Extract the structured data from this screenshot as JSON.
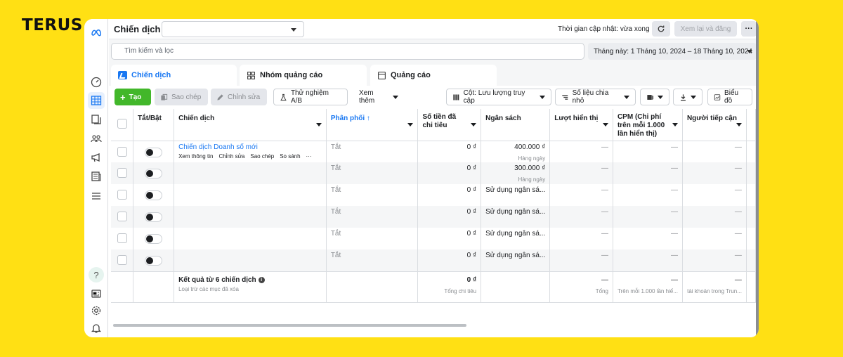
{
  "brand": {
    "text": "TERUS"
  },
  "topbar": {
    "title": "Chiến dịch",
    "campaign_select_value": "",
    "update_status": "Thời gian cập nhật: vừa xong",
    "review_button": "Xem lại và đăng",
    "more_button": "···"
  },
  "search": {
    "placeholder": "Tìm kiếm và lọc"
  },
  "date_range": "Tháng này: 1 Tháng 10, 2024 – 18 Tháng 10, 2024",
  "tabs": [
    {
      "label": "Chiến dịch"
    },
    {
      "label": "Nhóm quảng cáo"
    },
    {
      "label": "Quảng cáo"
    }
  ],
  "toolbar": {
    "create": "Tạo",
    "copy": "Sao chép",
    "edit": "Chỉnh sửa",
    "ab_test": "Thử nghiệm A/B",
    "see_more": "Xem thêm",
    "columns": "Cột: Lưu lượng truy cập",
    "breakdown": "Số liệu chia nhỏ",
    "chart": "Biểu đồ"
  },
  "columns": {
    "onoff": "Tắt/Bật",
    "campaign": "Chiến dịch",
    "delivery": "Phân phối ↑",
    "spent": "Số tiền đã chi tiêu",
    "budget": "Ngân sách",
    "impressions": "Lượt hiển thị",
    "cpm": "CPM (Chi phí trên mỗi 1.000 lần hiển thị)",
    "reach": "Người tiếp cận"
  },
  "rows": [
    {
      "name": "Chiến dịch Doanh số mới",
      "delivery": "Tắt",
      "spent": "0 ₫",
      "budget": "400.000 ₫",
      "budget_sub": "Hàng ngày",
      "impressions": "—",
      "cpm": "—",
      "reach": "—"
    },
    {
      "name": "",
      "delivery": "Tắt",
      "spent": "0 ₫",
      "budget": "300.000 ₫",
      "budget_sub": "Hàng ngày",
      "impressions": "—",
      "cpm": "—",
      "reach": "—"
    },
    {
      "name": "",
      "delivery": "Tắt",
      "spent": "0 ₫",
      "budget": "Sử dụng ngân sá...",
      "budget_sub": "",
      "impressions": "—",
      "cpm": "—",
      "reach": "—"
    },
    {
      "name": "",
      "delivery": "Tắt",
      "spent": "0 ₫",
      "budget": "Sử dụng ngân sá...",
      "budget_sub": "",
      "impressions": "—",
      "cpm": "—",
      "reach": "—"
    },
    {
      "name": "",
      "delivery": "Tắt",
      "spent": "0 ₫",
      "budget": "Sử dụng ngân sá...",
      "budget_sub": "",
      "impressions": "—",
      "cpm": "—",
      "reach": "—"
    },
    {
      "name": "",
      "delivery": "Tắt",
      "spent": "0 ₫",
      "budget": "Sử dụng ngân sá...",
      "budget_sub": "",
      "impressions": "—",
      "cpm": "—",
      "reach": "—"
    }
  ],
  "row_actions": [
    "Xem thông tin",
    "Chỉnh sửa",
    "Sao chép",
    "So sánh",
    "···"
  ],
  "footer": {
    "title": "Kết quả từ 6 chiến dịch",
    "subtitle": "Loại trừ các mục đã xóa",
    "spent": "0 ₫",
    "spent_sub": "Tổng chi tiêu",
    "impressions": "—",
    "impressions_sub": "Tổng",
    "cpm": "—",
    "cpm_sub": "Trên mỗi 1.000 lần hiể...",
    "reach": "—",
    "reach_sub": "tài khoản trong Trun..."
  }
}
